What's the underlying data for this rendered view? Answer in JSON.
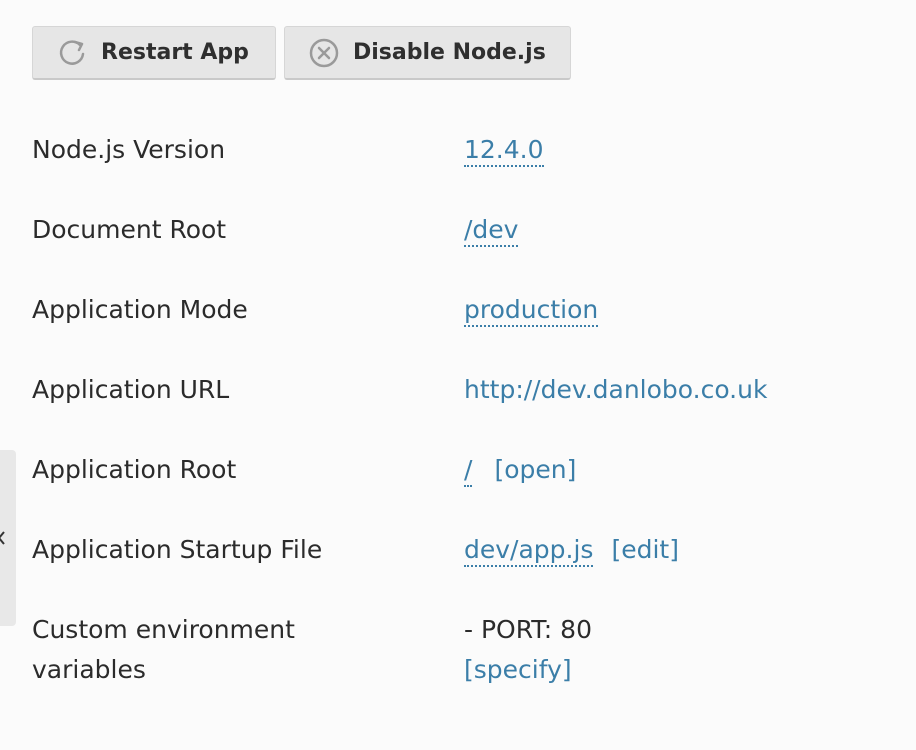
{
  "toolbar": {
    "restart_label": "Restart App",
    "disable_label": "Disable Node.js"
  },
  "props": {
    "node_version": {
      "label": "Node.js Version",
      "value": "12.4.0"
    },
    "document_root": {
      "label": "Document Root",
      "value": "/dev"
    },
    "app_mode": {
      "label": "Application Mode",
      "value": "production"
    },
    "app_url": {
      "label": "Application URL",
      "value": "http://dev.danlobo.co.uk"
    },
    "app_root": {
      "label": "Application Root",
      "value": "/",
      "action": "[open]"
    },
    "startup_file": {
      "label": "Application Startup File",
      "value": "dev/app.js",
      "action": "[edit]"
    },
    "custom_env": {
      "label_line1": "Custom environment",
      "label_line2": "variables",
      "value": "- PORT: 80",
      "action": "[specify]"
    }
  },
  "colors": {
    "link": "#3b7ea8",
    "button_bg": "#e6e6e6",
    "page_bg": "#fbfbfb"
  }
}
